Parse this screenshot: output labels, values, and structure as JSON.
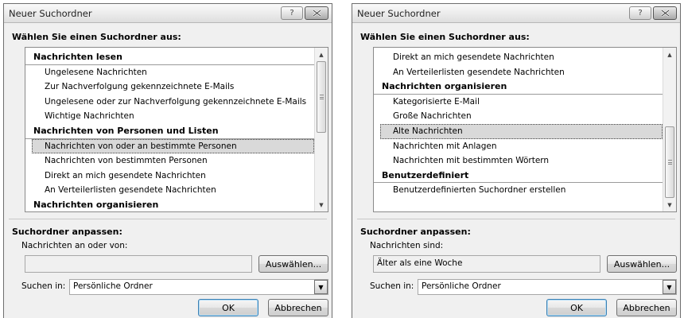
{
  "dialogs": [
    {
      "title": "Neuer Suchordner",
      "help_label": "?",
      "choose_label": "Wählen Sie einen Suchordner aus:",
      "rows": [
        {
          "kind": "header",
          "text": "Nachrichten lesen"
        },
        {
          "kind": "item",
          "text": "Ungelesene Nachrichten"
        },
        {
          "kind": "item",
          "text": "Zur Nachverfolgung gekennzeichnete E-Mails"
        },
        {
          "kind": "item",
          "text": "Ungelesene oder zur Nachverfolgung gekennzeichnete E-Mails"
        },
        {
          "kind": "item",
          "text": "Wichtige Nachrichten"
        },
        {
          "kind": "header",
          "text": "Nachrichten von Personen und Listen"
        },
        {
          "kind": "item",
          "text": "Nachrichten von oder an bestimmte Personen",
          "selected": true
        },
        {
          "kind": "item",
          "text": "Nachrichten von bestimmten Personen"
        },
        {
          "kind": "item",
          "text": "Direkt an mich gesendete Nachrichten"
        },
        {
          "kind": "item",
          "text": "An Verteilerlisten gesendete Nachrichten"
        },
        {
          "kind": "header",
          "text": "Nachrichten organisieren"
        }
      ],
      "scroll_position": 0.0,
      "customize_label": "Suchordner anpassen:",
      "criteria_label": "Nachrichten an oder von:",
      "criteria_value": "",
      "select_button": "Auswählen...",
      "search_in_label": "Suchen in:",
      "search_in_value": "Persönliche Ordner",
      "ok_button": "OK",
      "cancel_button": "Abbrechen"
    },
    {
      "title": "Neuer Suchordner",
      "help_label": "?",
      "choose_label": "Wählen Sie einen Suchordner aus:",
      "rows": [
        {
          "kind": "item",
          "text": "Direkt an mich gesendete Nachrichten"
        },
        {
          "kind": "item",
          "text": "An Verteilerlisten gesendete Nachrichten"
        },
        {
          "kind": "header",
          "text": "Nachrichten organisieren"
        },
        {
          "kind": "item",
          "text": "Kategorisierte E-Mail"
        },
        {
          "kind": "item",
          "text": "Große Nachrichten"
        },
        {
          "kind": "item",
          "text": "Alte Nachrichten",
          "selected": true
        },
        {
          "kind": "item",
          "text": "Nachrichten mit Anlagen"
        },
        {
          "kind": "item",
          "text": "Nachrichten mit bestimmten Wörtern"
        },
        {
          "kind": "header",
          "text": "Benutzerdefiniert"
        },
        {
          "kind": "item",
          "text": "Benutzerdefinierten Suchordner erstellen"
        }
      ],
      "scroll_position": 1.0,
      "customize_label": "Suchordner anpassen:",
      "criteria_label": "Nachrichten sind:",
      "criteria_value": "Älter als eine Woche",
      "select_button": "Auswählen...",
      "search_in_label": "Suchen in:",
      "search_in_value": "Persönliche Ordner",
      "ok_button": "OK",
      "cancel_button": "Abbrechen"
    }
  ]
}
